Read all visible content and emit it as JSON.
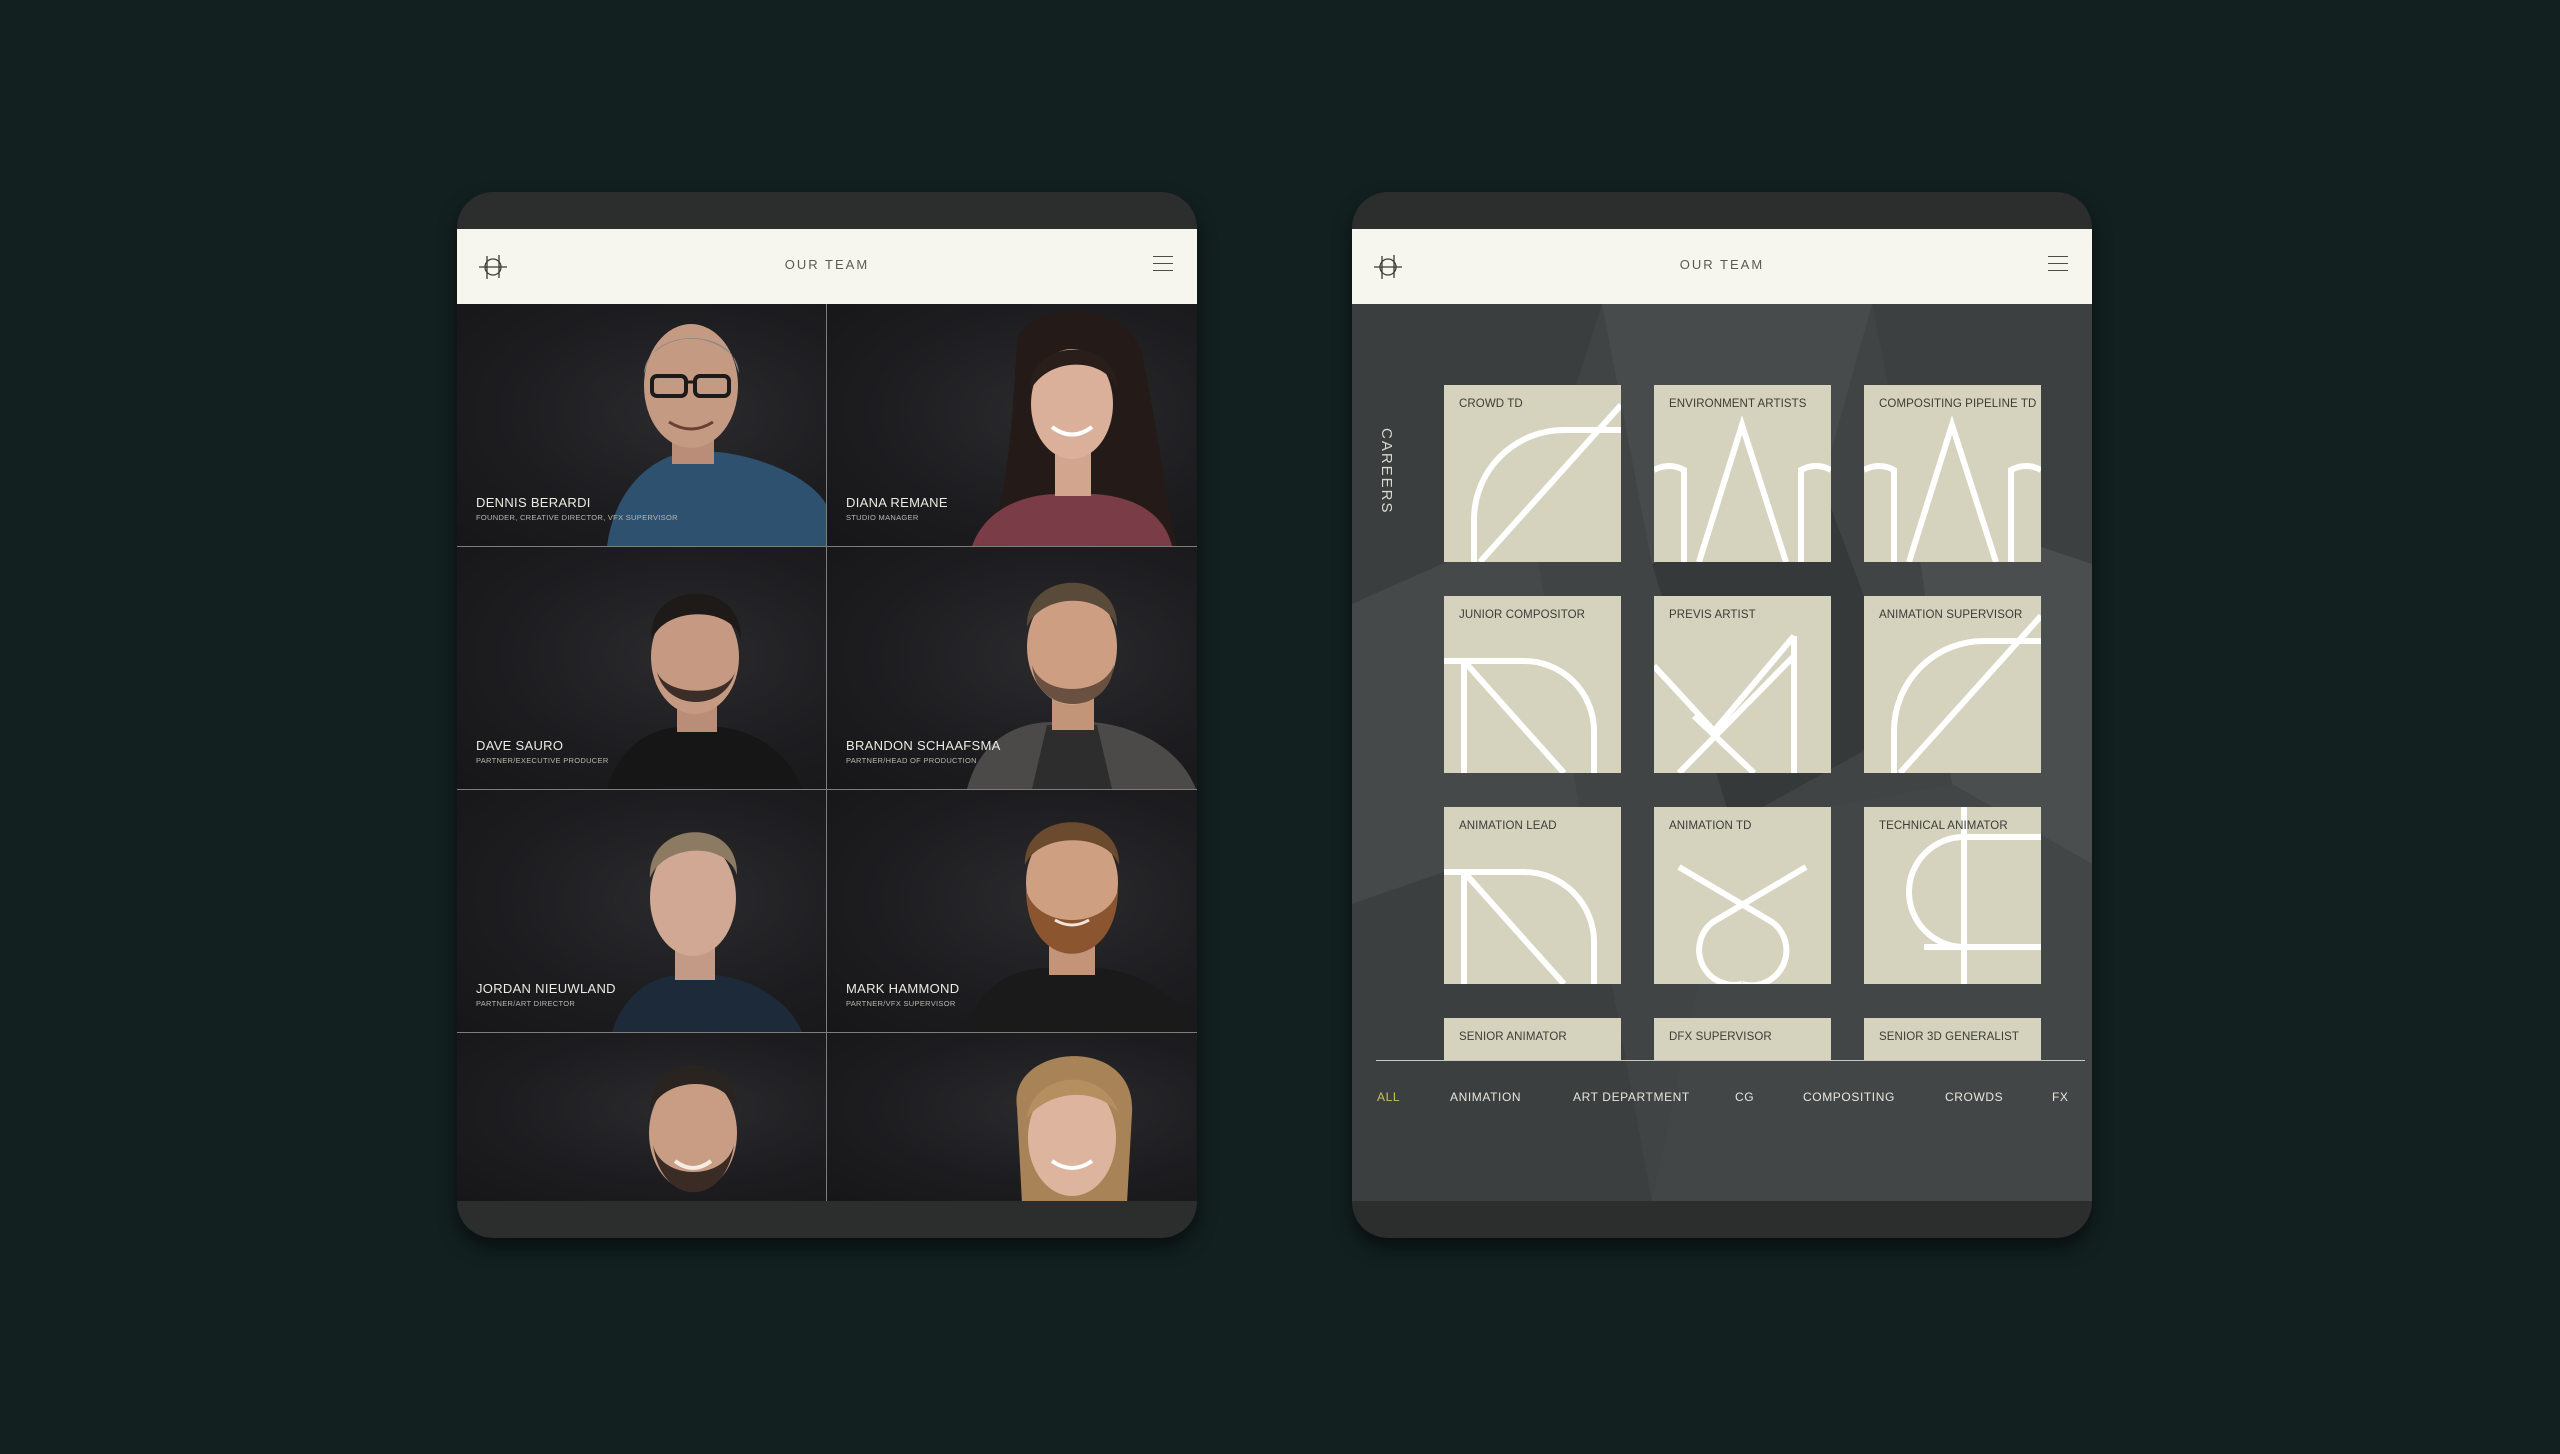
{
  "left_screen": {
    "header_title": "OUR TEAM",
    "team": [
      {
        "name": "DENNIS BERARDI",
        "role": "FOUNDER, CREATIVE DIRECTOR, VFX SUPERVISOR"
      },
      {
        "name": "DIANA REMANE",
        "role": "STUDIO MANAGER"
      },
      {
        "name": "DAVE SAURO",
        "role": "PARTNER/EXECUTIVE PRODUCER"
      },
      {
        "name": "BRANDON SCHAAFSMA",
        "role": "PARTNER/HEAD OF PRODUCTION"
      },
      {
        "name": "JORDAN NIEUWLAND",
        "role": "PARTNER/ART DIRECTOR"
      },
      {
        "name": "MARK HAMMOND",
        "role": "PARTNER/VFX SUPERVISOR"
      },
      {
        "name": "",
        "role": ""
      },
      {
        "name": "",
        "role": ""
      }
    ]
  },
  "right_screen": {
    "header_title": "OUR TEAM",
    "section_label": "CAREERS",
    "jobs": [
      "CROWD TD",
      "ENVIRONMENT ARTISTS",
      "COMPOSITING PIPELINE TD",
      "JUNIOR COMPOSITOR",
      "PREVIS ARTIST",
      "ANIMATION SUPERVISOR",
      "ANIMATION LEAD",
      "ANIMATION TD",
      "TECHNICAL ANIMATOR",
      "SENIOR ANIMATOR",
      "DFX SUPERVISOR",
      "SENIOR 3D GENERALIST"
    ],
    "filters": [
      "ALL",
      "ANIMATION",
      "ART DEPARTMENT",
      "CG",
      "COMPOSITING",
      "CROWDS",
      "FX"
    ],
    "active_filter": "ALL"
  },
  "colors": {
    "background": "#132020",
    "header": "#f7f6ee",
    "card": "#d5d3bd",
    "active_filter": "#c7c25a"
  }
}
